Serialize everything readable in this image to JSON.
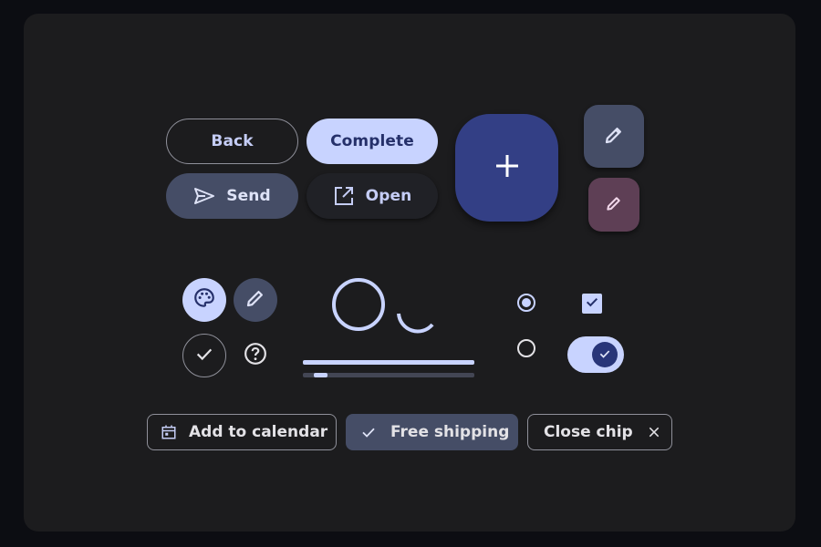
{
  "buttons": {
    "back": "Back",
    "complete": "Complete",
    "send": "Send",
    "open": "Open"
  },
  "chips": {
    "add_to_calendar": "Add to calendar",
    "free_shipping": "Free shipping",
    "close_chip": "Close chip"
  },
  "progress": {
    "linear_indeterminate_fraction": 0.08
  },
  "controls": {
    "radio_top_selected": true,
    "radio_bottom_selected": false,
    "checkbox_checked": true,
    "switch_on": true
  },
  "colors": {
    "background": "#0c0d12",
    "surface": "#1c1c1e",
    "primary": "#c8d3ff",
    "on_primary": "#25306a",
    "secondary_container": "#454d66",
    "fab_large": "#333f85",
    "tertiary_container": "#5e3f55",
    "outline": "#8f909a"
  },
  "icons": [
    "send-icon",
    "open-in-new-icon",
    "add-icon",
    "pencil-icon",
    "palette-icon",
    "check-icon",
    "help-circle-icon",
    "calendar-icon",
    "close-icon"
  ]
}
